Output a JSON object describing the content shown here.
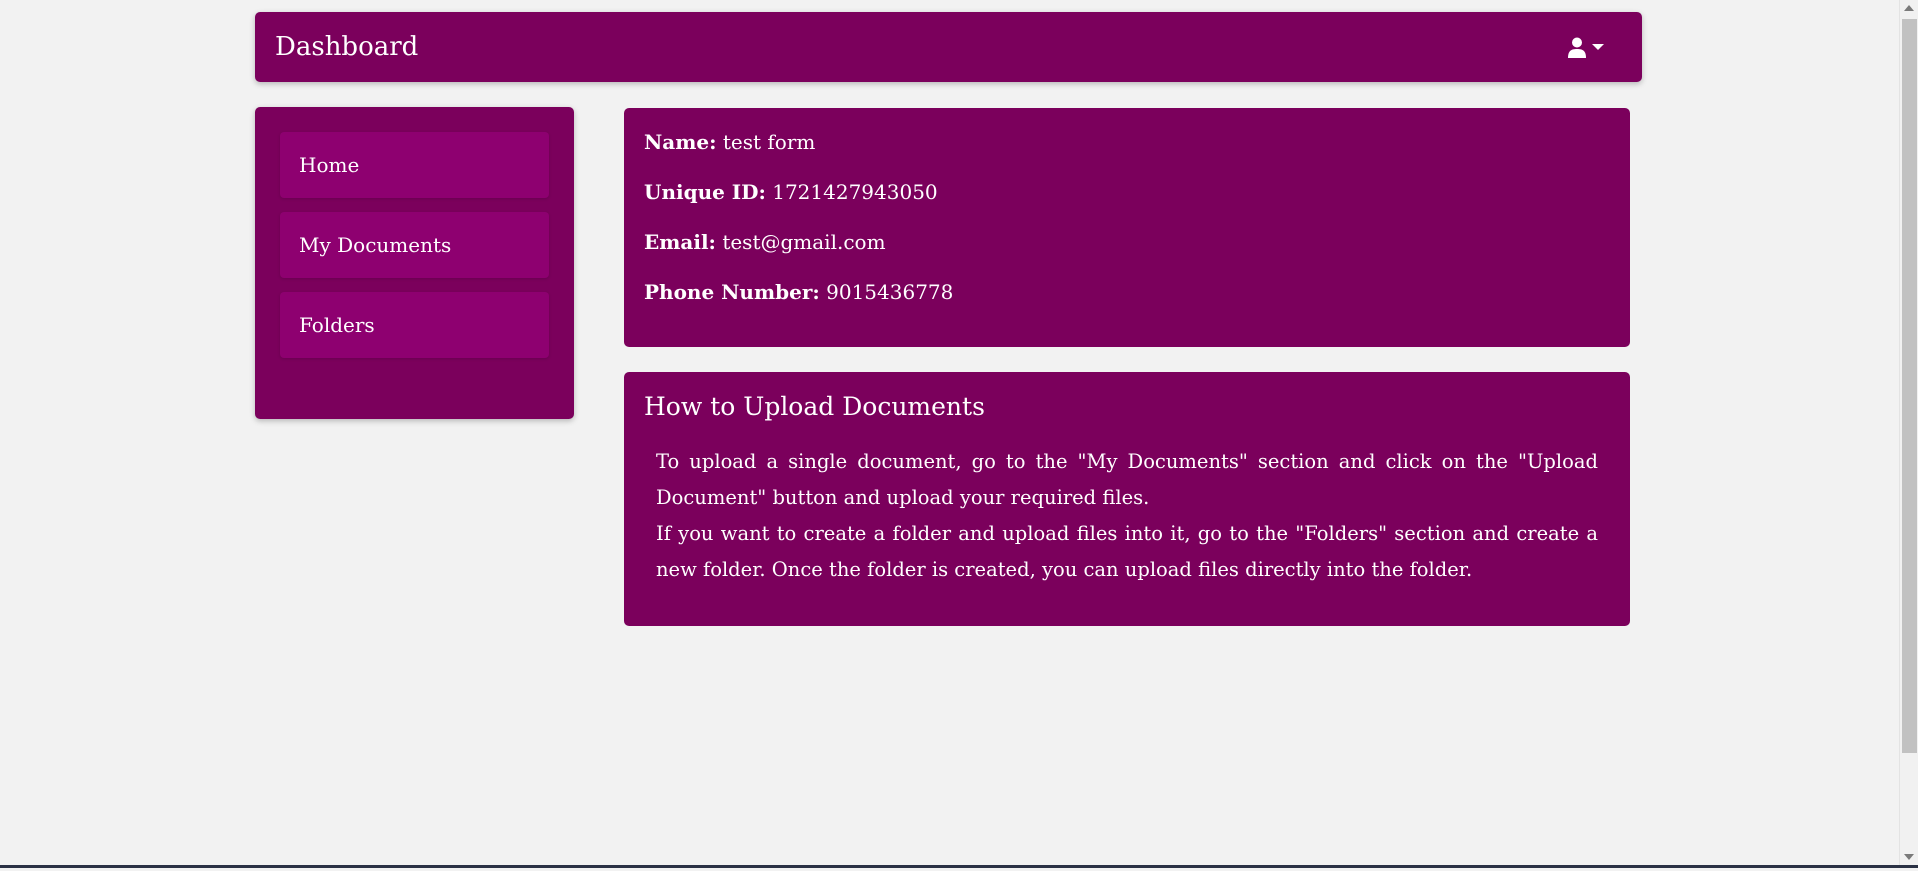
{
  "header": {
    "title": "Dashboard",
    "user_icon": "user-icon",
    "dropdown_icon": "caret-down-icon"
  },
  "sidebar": {
    "items": [
      {
        "label": "Home"
      },
      {
        "label": "My Documents"
      },
      {
        "label": "Folders"
      }
    ]
  },
  "profile": {
    "name_label": "Name:",
    "name_value": "test form",
    "id_label": "Unique ID:",
    "id_value": "1721427943050",
    "email_label": "Email:",
    "email_value": "test@gmail.com",
    "phone_label": "Phone Number:",
    "phone_value": "9015436778"
  },
  "upload_info": {
    "title": "How to Upload Documents",
    "paragraph_1": "To upload a single document, go to the \"My Documents\" section and click on the \"Upload Document\" button and upload your required files.",
    "paragraph_2": "If you want to create a folder and upload files into it, go to the \"Folders\" section and create a new folder. Once the folder is created, you can upload files directly into the folder."
  },
  "colors": {
    "primary": "#7b005c",
    "sidebar_item": "#8e0070",
    "background": "#f2f2f2",
    "text": "#ffffff"
  }
}
